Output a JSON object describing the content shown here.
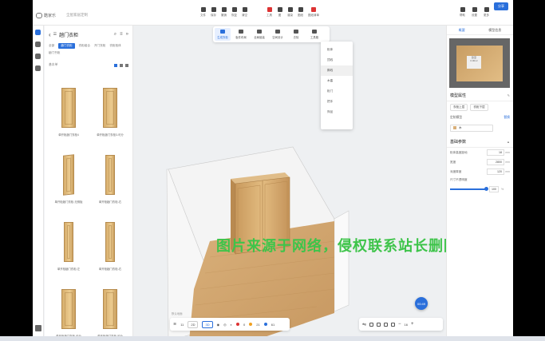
{
  "topbar": {
    "brand": "酷家乐",
    "file_name": "全屋家居定制",
    "tools": [
      {
        "label": "文件",
        "icon": "file-icon"
      },
      {
        "label": "保存",
        "icon": "save-icon"
      },
      {
        "label": "撤销",
        "icon": "undo-icon"
      },
      {
        "label": "恢复",
        "icon": "redo-icon"
      },
      {
        "label": "清空",
        "icon": "clear-icon"
      }
    ],
    "tools2": [
      {
        "label": "工具",
        "icon": "tools-icon",
        "red": true
      },
      {
        "label": "图",
        "icon": "drawing-icon"
      },
      {
        "label": "渲染",
        "icon": "render-icon"
      },
      {
        "label": "图纸",
        "icon": "blueprint-icon"
      },
      {
        "label": "图纸清单",
        "icon": "list-icon",
        "red": true
      }
    ],
    "right": [
      {
        "label": "帮助",
        "icon": "help-icon"
      },
      {
        "label": "设置",
        "icon": "settings-icon"
      },
      {
        "label": "更多",
        "icon": "more-icon"
      }
    ],
    "share_label": "分享"
  },
  "left_panel": {
    "title": "趟门衣柜",
    "filters": [
      "全部",
      "趟门衣柜",
      "衣柜组合",
      "开门衣柜",
      "衣柜柜体",
      "趟门书柜"
    ],
    "active_filter": 1,
    "sub_label": "基本单",
    "items": [
      {
        "caption": "单开柜趟门衣柜4",
        "shape": "wide"
      },
      {
        "caption": "单开柜趟门衣柜3-可分",
        "shape": "wide"
      },
      {
        "caption": "单开柜趟门衣柜-无侧板",
        "shape": "open"
      },
      {
        "caption": "单开柜趟门衣柜-右",
        "shape": "narrow"
      },
      {
        "caption": "单开柜趟门衣柜-左",
        "shape": "narrow"
      },
      {
        "caption": "单开柜趟门衣柜-右",
        "shape": "narrow"
      },
      {
        "caption": "单开柜趟门衣柜-可分",
        "shape": "wide"
      },
      {
        "caption": "单开柜趟门衣柜-可分",
        "shape": "wide"
      }
    ]
  },
  "subtoolbar": {
    "items": [
      "生成衣柜",
      "板件布局",
      "全局组装",
      "空间设计",
      "去除",
      "工具箱"
    ],
    "active": 0
  },
  "dropdown": {
    "items": [
      "柜体",
      "顶线",
      "脚线",
      "木塞",
      "柜门",
      "把手",
      "饰品"
    ],
    "hover": 2
  },
  "scene": {
    "floor_label": "默认地面",
    "view_modes": [
      "2D",
      "3D"
    ],
    "active_view": 1,
    "layer_count": "11",
    "count_a": "0",
    "count_b": "21",
    "count_c": "61",
    "zoom": "16",
    "fab_label": "00:49"
  },
  "watermark": "图片来源于网络，侵权联系站长删除！",
  "right_panel": {
    "tabs": [
      "概要",
      "模型信息"
    ],
    "active_tab": 0,
    "minimap_label": "卧室",
    "minimap_area": "0.00m²",
    "section1_title": "模型属性",
    "chip1": "衣柜上层",
    "chip2": "衣柜下层",
    "link": "替换",
    "material_label": "定制模型",
    "material_value": "木",
    "section2_title": "基础参数",
    "params": [
      {
        "label": "柜体高度距地",
        "value": "18",
        "unit": "mm"
      },
      {
        "label": "宽度",
        "value": "2800",
        "unit": "mm"
      },
      {
        "label": "深度厚度",
        "value": "120",
        "unit": "mm"
      },
      {
        "label": "尺寸不透明度",
        "value": "",
        "unit": ""
      }
    ],
    "slider_value": "100",
    "slider_unit": "%",
    "slider_fraction": 1.0
  }
}
